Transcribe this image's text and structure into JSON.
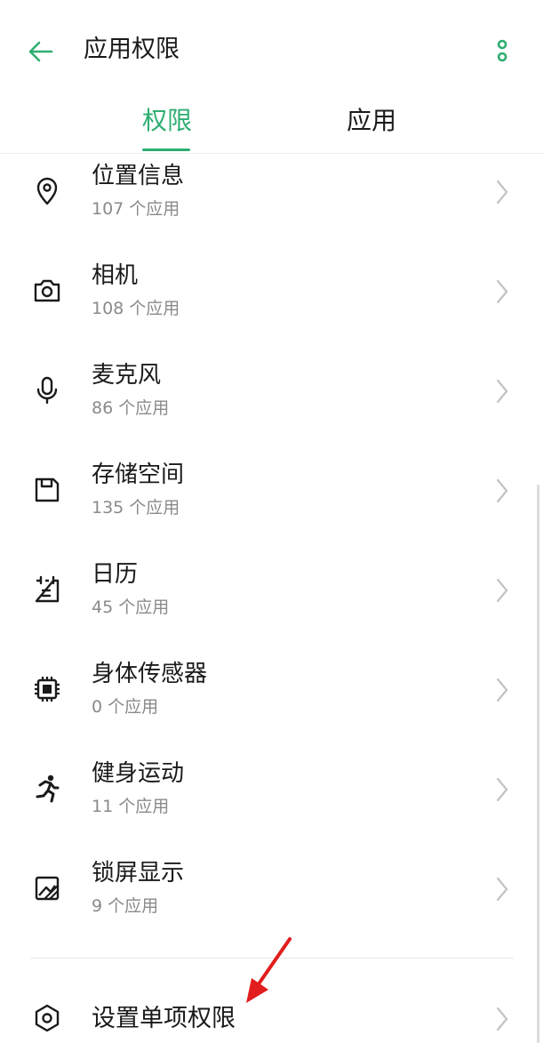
{
  "header": {
    "title": "应用权限",
    "back_icon": "arrow-left-icon",
    "more_icon": "more-vertical-icon"
  },
  "tabs": [
    {
      "label": "权限",
      "selected": true
    },
    {
      "label": "应用",
      "selected": false
    }
  ],
  "colors": {
    "accent": "#2fae72",
    "annotation_arrow": "#e21d1d"
  },
  "permissions": [
    {
      "title": "位置信息",
      "count": "107 个应用",
      "icon": "location-pin-icon"
    },
    {
      "title": "相机",
      "count": "108 个应用",
      "icon": "camera-icon"
    },
    {
      "title": "麦克风",
      "count": "86 个应用",
      "icon": "microphone-icon"
    },
    {
      "title": "存储空间",
      "count": "135 个应用",
      "icon": "storage-icon"
    },
    {
      "title": "日历",
      "count": "45 个应用",
      "icon": "calendar-icon"
    },
    {
      "title": "身体传感器",
      "count": "0 个应用",
      "icon": "chip-sensor-icon"
    },
    {
      "title": "健身运动",
      "count": "11 个应用",
      "icon": "running-person-icon"
    },
    {
      "title": "锁屏显示",
      "count": "9 个应用",
      "icon": "lockscreen-image-icon"
    }
  ],
  "single_permission": {
    "title": "设置单项权限",
    "icon": "hexagon-settings-icon"
  }
}
